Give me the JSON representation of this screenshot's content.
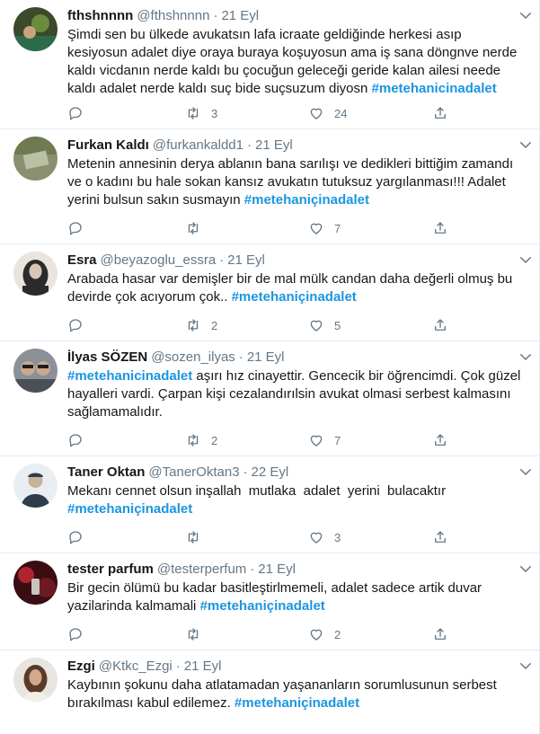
{
  "tweets": [
    {
      "name": "fthshnnnn",
      "handle": "@fthshnnnn",
      "date": "21 Eyl",
      "text": "Şimdi sen bu ülkede avukatsın lafa icraate geldiğinde herkesi asıp kesiyosun adalet diye oraya buraya koşuyosun ama iş sana döngnve nerde kaldı vicdanın nerde kaldı bu çocuğun geleceği geride kalan ailesi neede kaldı adalet nerde kaldı suç bide suçsuzum diyosn",
      "hashtag": "#metehanicinadalet",
      "replies": "",
      "retweets": "3",
      "likes": "24",
      "avatar_colors": [
        "#3b4a2a",
        "#6d8b3c",
        "#2e6b4a"
      ]
    },
    {
      "name": "Furkan Kaldı",
      "handle": "@furkankaldd1",
      "date": "21 Eyl",
      "text": "Metenin annesinin derya ablanın bana sarılışı ve dedikleri bittiğim zamandı ve o kadını bu hale sokan kansız avukatın tutuksuz yargılanması!!! Adalet yerini bulsun sakın susmayın",
      "hashtag": "#metehaniçinadalet",
      "replies": "",
      "retweets": "",
      "likes": "7",
      "avatar_colors": [
        "#6f7a52",
        "#b9c1a4",
        "#8a8f6f"
      ]
    },
    {
      "name": "Esra",
      "handle": "@beyazoglu_essra",
      "date": "21 Eyl",
      "text": "Arabada hasar var demişler bir de mal mülk candan daha değerli olmuş bu devirde çok acıyorum çok..",
      "hashtag": "#metehaniçinadalet",
      "replies": "",
      "retweets": "2",
      "likes": "5",
      "avatar_colors": [
        "#2b2b2b",
        "#d8c7b6",
        "#6b5a4e"
      ]
    },
    {
      "name": "İlyas SÖZEN",
      "handle": "@sozen_ilyas",
      "date": "21 Eyl",
      "text": "aşırı hız cinayettir. Gencecik bir öğrencimdi. Çok güzel hayalleri vardi. Çarpan kişi cezalandırılsin avukat olmasi serbest kalmasını sağlamamalıdır.",
      "hashtag": "#metehanicinadalet",
      "replies": "",
      "retweets": "2",
      "likes": "7",
      "avatar_colors": [
        "#4a4f58",
        "#c9a98f",
        "#8b9099"
      ]
    },
    {
      "name": "Taner Oktan",
      "handle": "@TanerOktan3",
      "date": "22 Eyl",
      "text": "Mekanı cennet olsun inşallah  mutlaka  adalet  yerini  bulacaktır",
      "hashtag": "#metehaniçinadalet",
      "replies": "",
      "retweets": "",
      "likes": "3",
      "avatar_colors": [
        "#e9eef2",
        "#2f3c4a",
        "#c8b29a"
      ]
    },
    {
      "name": "tester parfum",
      "handle": "@testerperfum",
      "date": "21 Eyl",
      "text": "Bir gecin ölümü bu kadar basitleştirlmemeli, adalet sadece artik duvar yazilarinda kalmamali",
      "hashtag": "#metehaniçinadalet",
      "replies": "",
      "retweets": "",
      "likes": "2",
      "avatar_colors": [
        "#3a0d12",
        "#b0232f",
        "#6e1a22"
      ]
    },
    {
      "name": "Ezgi",
      "handle": "@Ktkc_Ezgi",
      "date": "21 Eyl",
      "text": "Kaybının şokunu daha atlatamadan yaşananların sorumlusunun serbest bırakılması kabul edilemez.",
      "hashtag": "#metehaniçinadalet",
      "replies": "",
      "retweets": "",
      "likes": "",
      "avatar_colors": [
        "#e8e4df",
        "#5a3b28",
        "#d2a98c"
      ]
    }
  ],
  "colors": {
    "hashtag": "#1b95e0",
    "secondary_text": "#657786",
    "divider": "#e6ecf0"
  },
  "icons": {
    "reply": "reply-icon",
    "retweet": "retweet-icon",
    "like": "heart-icon",
    "share": "share-icon",
    "more": "chevron-down-icon"
  }
}
